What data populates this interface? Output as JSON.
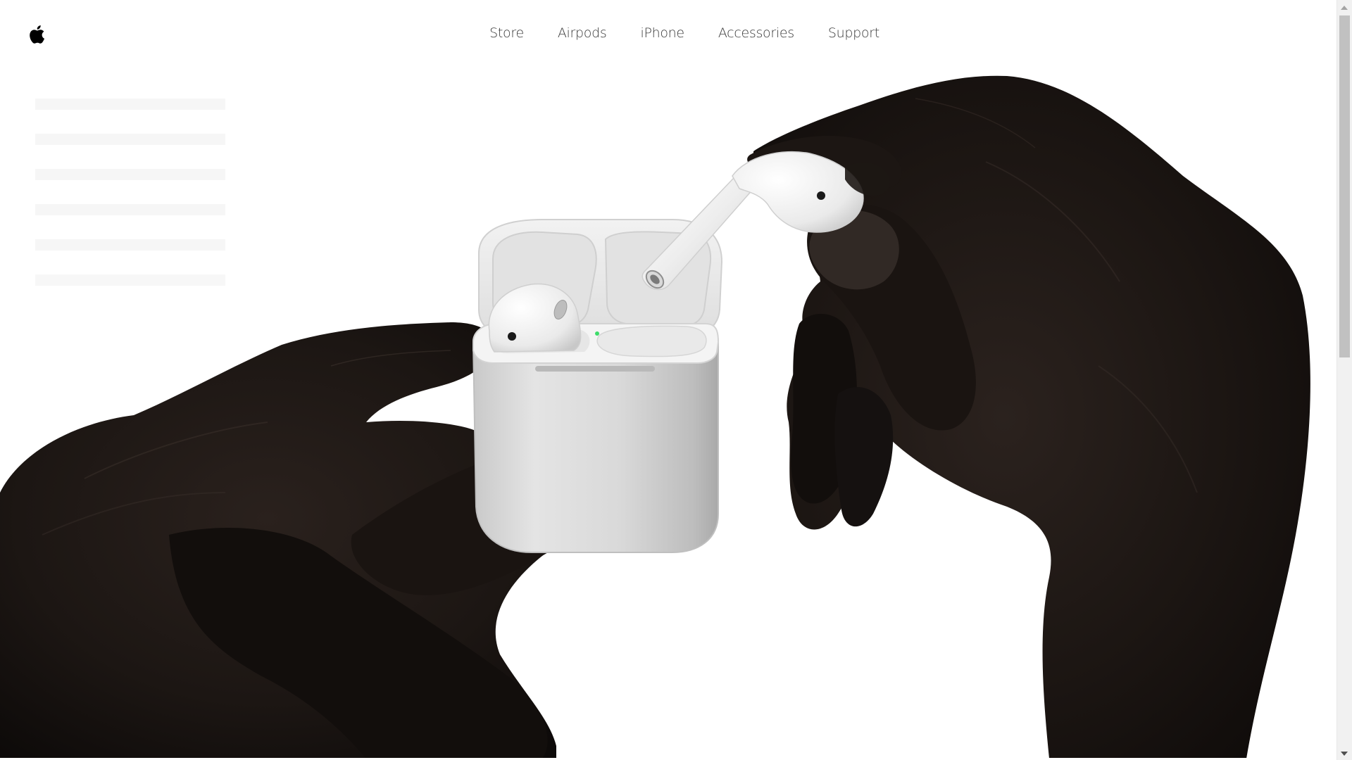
{
  "nav": {
    "logo": "apple-logo-icon",
    "items": [
      {
        "label": "Store"
      },
      {
        "label": "Airpods"
      },
      {
        "label": "iPhone"
      },
      {
        "label": "Accessories"
      },
      {
        "label": "Support"
      }
    ]
  },
  "hero": {
    "image": "hands-holding-airpods-case-photo",
    "colors": {
      "background": "#ffffff",
      "skin": "#1d1714",
      "device": "#e9e9e9",
      "status_light": "#3ddc6a"
    }
  },
  "scrollbar": {
    "track_color": "#f1f1f1",
    "thumb_color": "#c1c1c1"
  }
}
